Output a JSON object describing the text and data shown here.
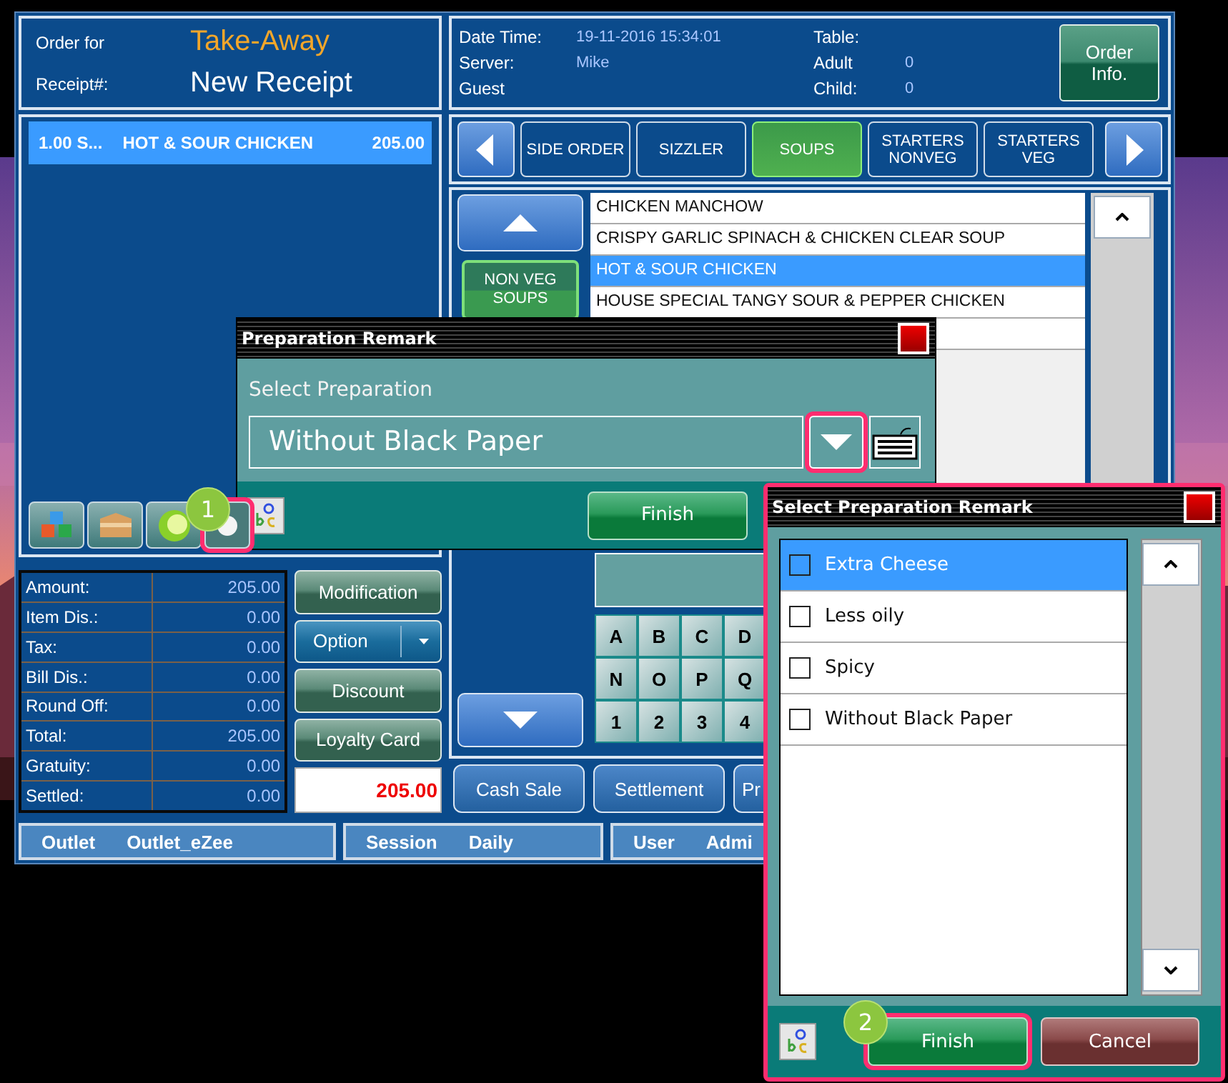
{
  "order_header": {
    "order_for_label": "Order for",
    "order_for": "Take-Away",
    "receipt_label": "Receipt#:",
    "receipt": "New Receipt"
  },
  "info": {
    "fields": [
      {
        "label": "Date Time:",
        "value": "19-11-2016 15:34:01"
      },
      {
        "label": "Server:",
        "value": "Mike"
      },
      {
        "label": "Guest"
      },
      {
        "label": "Table:"
      },
      {
        "label": "Adult",
        "value": "0"
      },
      {
        "label": "Child:",
        "value": "0"
      }
    ],
    "button": "Order Info."
  },
  "order_lines": [
    {
      "qty": "1.00 S...",
      "name": "HOT & SOUR CHICKEN",
      "amount": "205.00",
      "selected": true
    }
  ],
  "toolbar": [
    {
      "kind": "cubes",
      "highlighted": false
    },
    {
      "kind": "box",
      "highlighted": false
    },
    {
      "kind": "lime",
      "highlighted": false
    },
    {
      "kind": "disc",
      "highlighted": true
    }
  ],
  "totals": [
    {
      "label": "Amount:",
      "value": "205.00"
    },
    {
      "label": "Item Dis.:",
      "value": "0.00"
    },
    {
      "label": "Tax:",
      "value": "0.00"
    },
    {
      "label": "Bill Dis.:",
      "value": "0.00"
    },
    {
      "label": "Round Off:",
      "value": "0.00"
    },
    {
      "label": "Total:",
      "value": "205.00"
    },
    {
      "label": "Gratuity:",
      "value": "0.00"
    },
    {
      "label": "Settled:",
      "value": "0.00"
    }
  ],
  "side_buttons": [
    {
      "label": "Modification",
      "kind": "plain"
    },
    {
      "label": "Option",
      "kind": "split"
    },
    {
      "label": "Discount",
      "kind": "plain"
    },
    {
      "label": "Loyalty Card",
      "kind": "plain"
    }
  ],
  "balance": "205.00",
  "categories": [
    {
      "label": "SIDE ORDER",
      "selected": false
    },
    {
      "label": "SIZZLER",
      "selected": false
    },
    {
      "label": "SOUPS",
      "selected": true
    },
    {
      "label": "STARTERS NONVEG",
      "selected": false
    },
    {
      "label": "STARTERS VEG",
      "selected": false
    }
  ],
  "subcategories": [
    {
      "label": "NON VEG SOUPS",
      "selected": true
    }
  ],
  "items": [
    {
      "name": "CHICKEN MANCHOW",
      "selected": false
    },
    {
      "name": "CRISPY GARLIC SPINACH & CHICKEN CLEAR SOUP",
      "selected": false
    },
    {
      "name": "HOT & SOUR CHICKEN",
      "selected": true
    },
    {
      "name": "HOUSE SPECIAL TANGY SOUR & PEPPER CHICKEN",
      "selected": false
    }
  ],
  "keypad": {
    "keys": [
      "A",
      "B",
      "C",
      "D",
      "N",
      "O",
      "P",
      "Q",
      "1",
      "2",
      "3",
      "4"
    ]
  },
  "actions": [
    "Cash Sale",
    "Settlement",
    "Pr"
  ],
  "status_bar": [
    {
      "label": "Outlet",
      "value": "Outlet_eZee"
    },
    {
      "label": "Session",
      "value": "Daily"
    },
    {
      "label": "User",
      "value": "Admi"
    }
  ],
  "preparation_dialog": {
    "title": "Preparation Remark",
    "prompt": "Select Preparation",
    "value": "Without Black Paper",
    "dropdown_highlighted": true,
    "finish": "Finish"
  },
  "remark_dialog": {
    "title": "Select Preparation Remark",
    "remarks": [
      {
        "label": "Extra Cheese",
        "checked": false,
        "selected": true
      },
      {
        "label": "Less oily",
        "checked": false,
        "selected": false
      },
      {
        "label": "Spicy",
        "checked": false,
        "selected": false
      },
      {
        "label": "Without Black Paper",
        "checked": false,
        "selected": false
      }
    ],
    "finish": "Finish",
    "finish_highlighted": true,
    "cancel": "Cancel"
  },
  "annotations": [
    {
      "number": "1"
    },
    {
      "number": "2"
    }
  ]
}
